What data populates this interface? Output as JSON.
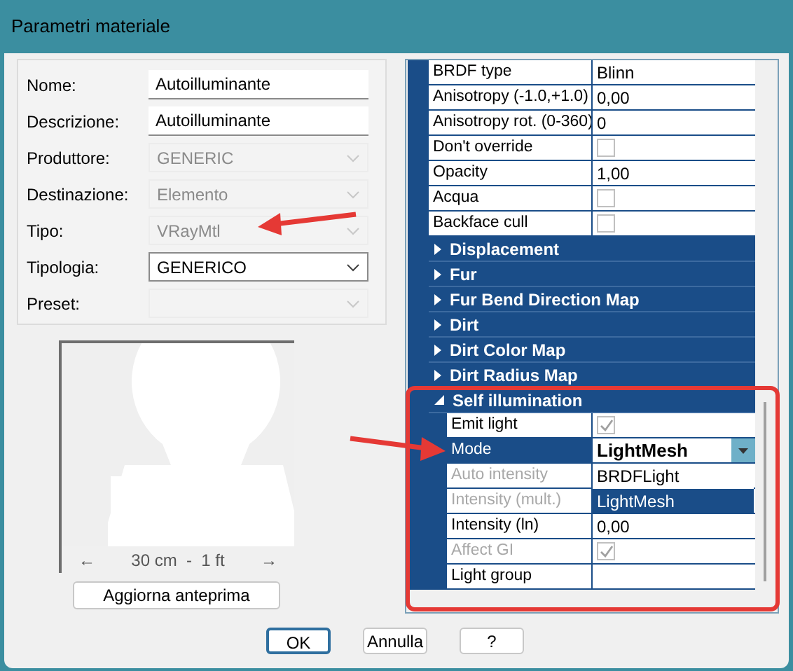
{
  "window": {
    "title": "Parametri materiale"
  },
  "form": {
    "fields": [
      {
        "label": "Nome:",
        "kind": "text",
        "value": "Autoilluminante",
        "disabled": false
      },
      {
        "label": "Descrizione:",
        "kind": "text",
        "value": "Autoilluminante",
        "disabled": false
      },
      {
        "label": "Produttore:",
        "kind": "dropdown",
        "value": "GENERIC",
        "disabled": true
      },
      {
        "label": "Destinazione:",
        "kind": "dropdown",
        "value": "Elemento",
        "disabled": true
      },
      {
        "label": "Tipo:",
        "kind": "dropdown",
        "value": "VRayMtl",
        "disabled": true
      },
      {
        "label": "Tipologia:",
        "kind": "dropdown",
        "value": "GENERICO",
        "disabled": false
      },
      {
        "label": "Preset:",
        "kind": "dropdown",
        "disabled": true
      }
    ]
  },
  "preview": {
    "kind": "picture",
    "left_arrow": "←",
    "scale": "30 cm  -  1 ft",
    "right_arrow": "→"
  },
  "update_button": "Aggiorna anteprima",
  "properties": {
    "rows": [
      {
        "kind": "value",
        "name": "BRDF type",
        "value": "Blinn"
      },
      {
        "kind": "value",
        "name": "Anisotropy (-1.0,+1.0)",
        "value": "0,00"
      },
      {
        "kind": "value",
        "name": "Anisotropy rot. (0-360)",
        "value": "0"
      },
      {
        "kind": "checkbox",
        "name": "Don't override",
        "checked": false
      },
      {
        "kind": "value",
        "name": "Opacity",
        "value": "1,00"
      },
      {
        "kind": "checkbox",
        "name": "Acqua",
        "checked": false
      },
      {
        "kind": "checkbox",
        "name": "Backface cull",
        "checked": false
      },
      {
        "kind": "category",
        "name": "Displacement",
        "expanded": false
      },
      {
        "kind": "category",
        "name": "Fur",
        "expanded": false
      },
      {
        "kind": "category",
        "name": "Fur Bend Direction Map",
        "expanded": false
      },
      {
        "kind": "category",
        "name": "Dirt",
        "expanded": false
      },
      {
        "kind": "category",
        "name": "Dirt Color Map",
        "expanded": false
      },
      {
        "kind": "category",
        "name": "Dirt Radius Map",
        "expanded": false
      },
      {
        "kind": "category",
        "name": "Self illumination",
        "expanded": true,
        "children": [
          {
            "kind": "checkbox",
            "name": "Emit light",
            "checked": true,
            "disabled": false
          },
          {
            "kind": "dropdown",
            "name": "Mode",
            "value": "LightMesh",
            "selected": true,
            "options": [
              {
                "label": "BRDFLight",
                "selected": false
              },
              {
                "label": "LightMesh",
                "selected": true
              }
            ]
          },
          {
            "kind": "value",
            "name": "Auto intensity",
            "disabled": true
          },
          {
            "kind": "value",
            "name": "Intensity (mult.)",
            "disabled": true
          },
          {
            "kind": "value",
            "name": "Intensity (ln)",
            "value": "0,00",
            "disabled": false
          },
          {
            "kind": "checkbox",
            "name": "Affect GI",
            "checked": true,
            "disabled": true
          },
          {
            "kind": "value",
            "name": "Light group",
            "disabled": false
          }
        ]
      }
    ]
  },
  "buttons": [
    {
      "label": "OK",
      "default": true
    },
    {
      "label": "Annulla",
      "default": false
    },
    {
      "label": "?",
      "default": false
    }
  ]
}
